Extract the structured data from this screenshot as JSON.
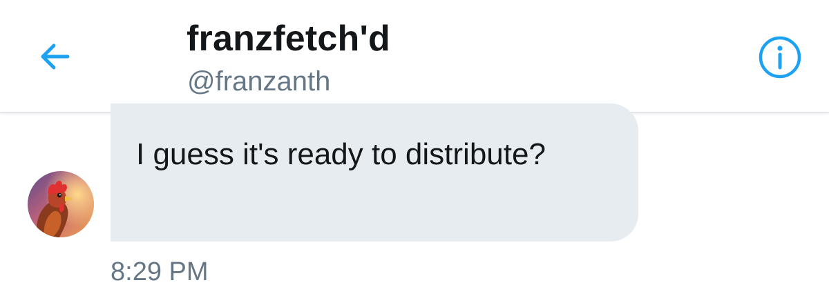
{
  "header": {
    "title": "franzfetch'd",
    "handle": "@franzanth",
    "back_icon": "arrow-left-icon",
    "info_icon": "info-icon",
    "accent_color": "#1da1f2"
  },
  "conversation": {
    "messages": [
      {
        "text": "I guess it's ready to distribute?",
        "timestamp": "8:29 PM",
        "avatar": "rooster-avatar"
      }
    ]
  }
}
